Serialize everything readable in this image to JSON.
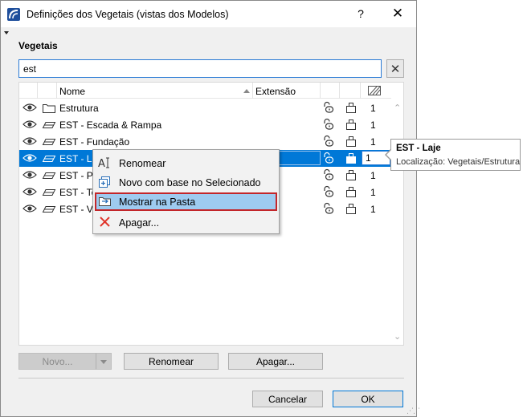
{
  "window": {
    "title": "Definições dos Vegetais (vistas dos Modelos)",
    "help_label": "?",
    "close_label": "✕"
  },
  "section_label": "Vegetais",
  "search": {
    "value": "est",
    "clear_label": "✕"
  },
  "columns": {
    "name": "Nome",
    "extension": "Extensão"
  },
  "rows": [
    {
      "name": "Estrutura",
      "type": "folder",
      "number": "1"
    },
    {
      "name": "EST - Escada & Rampa",
      "type": "layer",
      "number": "1"
    },
    {
      "name": "EST - Fundação",
      "type": "layer",
      "number": "1"
    },
    {
      "name": "EST - Laje",
      "type": "layer",
      "number": "1",
      "selected": true
    },
    {
      "name": "EST - Pila",
      "type": "layer",
      "number": "1"
    },
    {
      "name": "EST - Tec",
      "type": "layer",
      "number": "1"
    },
    {
      "name": "EST - Vig",
      "type": "layer",
      "number": "1"
    }
  ],
  "rows_visible_name_for_selected": "EST - Laj",
  "context_menu": {
    "items": [
      {
        "label": "Renomear",
        "icon": "rename-icon"
      },
      {
        "label": "Novo com base no Selecionado",
        "icon": "new-from-selected-icon"
      },
      {
        "label": "Mostrar na Pasta",
        "icon": "show-in-folder-icon",
        "highlighted": true
      },
      {
        "label": "Apagar...",
        "icon": "delete-icon"
      }
    ]
  },
  "tooltip": {
    "title": "EST - Laje",
    "location": "Localização: Vegetais/Estrutura"
  },
  "buttons": {
    "new": "Novo...",
    "rename": "Renomear",
    "delete": "Apagar...",
    "cancel": "Cancelar",
    "ok": "OK"
  },
  "colors": {
    "selection": "#0078d7",
    "menu_highlight": "#9ecbf0",
    "highlight_border": "#c3262a",
    "delete_icon": "#e0342a"
  }
}
